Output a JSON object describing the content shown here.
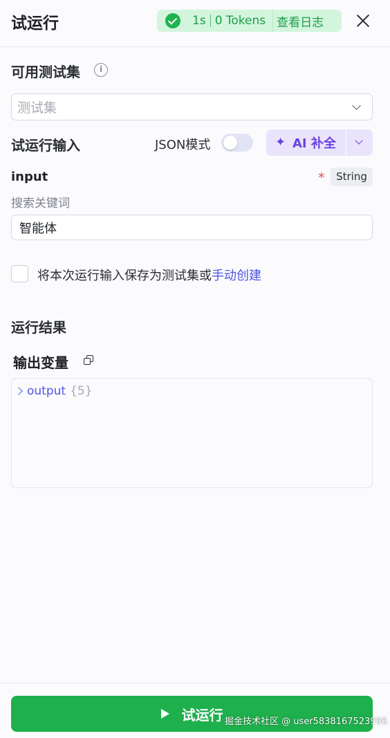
{
  "header": {
    "title": "试运行",
    "status": {
      "time": "1s",
      "tokens": "0 Tokens",
      "view_log": "查看日志"
    }
  },
  "testset": {
    "label": "可用测试集",
    "placeholder": "测试集"
  },
  "run_input": {
    "label": "试运行输入",
    "json_mode_label": "JSON模式",
    "json_mode_on": false,
    "ai_complete_label": "AI 补全"
  },
  "field": {
    "name": "input",
    "required_mark": "*",
    "type": "String",
    "description": "搜索关键词",
    "value": "智能体"
  },
  "save": {
    "text": "将本次运行输入保存为测试集或",
    "link": "手动创建",
    "checked": false
  },
  "results": {
    "label": "运行结果",
    "output_title": "输出变量",
    "tree": {
      "key": "output",
      "count": "{5}"
    }
  },
  "footer": {
    "run_label": "试运行"
  },
  "watermark": "掘金技术社区 @ user5838167523996",
  "colors": {
    "success": "#1eb04c",
    "accent_purple": "#6a41e0",
    "link_blue": "#4f55e0"
  }
}
